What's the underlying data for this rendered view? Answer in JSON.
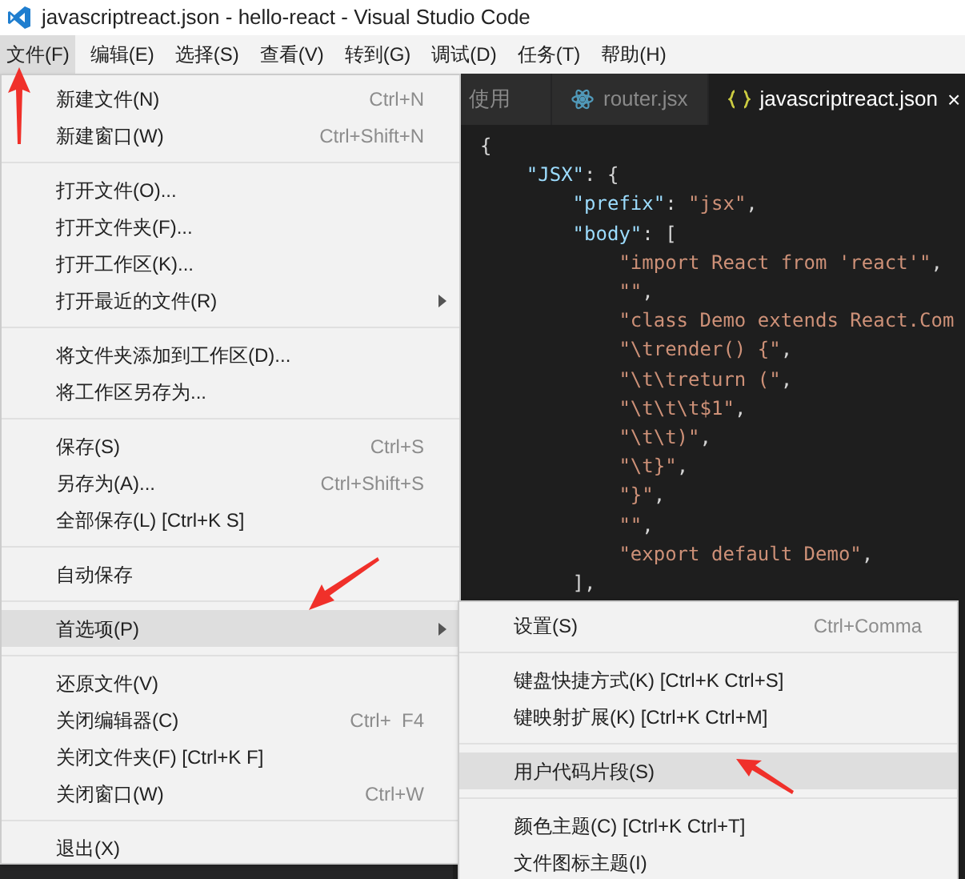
{
  "window": {
    "title": "javascriptreact.json - hello-react - Visual Studio Code"
  },
  "menu_bar": [
    {
      "label": "文件(F)",
      "selected": true
    },
    {
      "label": "编辑(E)",
      "selected": false
    },
    {
      "label": "选择(S)",
      "selected": false
    },
    {
      "label": "查看(V)",
      "selected": false
    },
    {
      "label": "转到(G)",
      "selected": false
    },
    {
      "label": "调试(D)",
      "selected": false
    },
    {
      "label": "任务(T)",
      "selected": false
    },
    {
      "label": "帮助(H)",
      "selected": false
    }
  ],
  "tabs": [
    {
      "label": "使用",
      "selected": false
    },
    {
      "label": "router.jsx",
      "selected": false
    },
    {
      "label": "javascriptreact.json",
      "selected": true,
      "close": "×"
    }
  ],
  "code": [
    {
      "tokens": [
        {
          "kind": "punct",
          "text": "{"
        }
      ],
      "children": [
        {
          "tokens": [
            {
              "kind": "key",
              "text": "\"JSX\""
            },
            {
              "kind": "punct",
              "text": ": {"
            }
          ],
          "children": [
            {
              "tokens": [
                {
                  "kind": "key",
                  "text": "\"prefix\""
                },
                {
                  "kind": "punct",
                  "text": ": "
                },
                {
                  "kind": "string",
                  "text": "\"jsx\""
                },
                {
                  "kind": "punct",
                  "text": ","
                }
              ]
            },
            {
              "tokens": [
                {
                  "kind": "key",
                  "text": "\"body\""
                },
                {
                  "kind": "punct",
                  "text": ": ["
                }
              ],
              "children": [
                {
                  "tokens": [
                    {
                      "kind": "string",
                      "text": "\"import React from 'react'\""
                    },
                    {
                      "kind": "punct",
                      "text": ","
                    }
                  ]
                },
                {
                  "tokens": [
                    {
                      "kind": "string",
                      "text": "\"\""
                    },
                    {
                      "kind": "punct",
                      "text": ","
                    }
                  ]
                },
                {
                  "tokens": [
                    {
                      "kind": "string",
                      "text": "\"class Demo extends React.Com"
                    }
                  ]
                },
                {
                  "tokens": [
                    {
                      "kind": "string",
                      "text": "\"\\trender() {\""
                    },
                    {
                      "kind": "punct",
                      "text": ","
                    }
                  ]
                },
                {
                  "tokens": [
                    {
                      "kind": "string",
                      "text": "\"\\t\\treturn (\""
                    },
                    {
                      "kind": "punct",
                      "text": ","
                    }
                  ]
                },
                {
                  "tokens": [
                    {
                      "kind": "string",
                      "text": "\"\\t\\t\\t$1\""
                    },
                    {
                      "kind": "punct",
                      "text": ","
                    }
                  ]
                },
                {
                  "tokens": [
                    {
                      "kind": "string",
                      "text": "\"\\t\\t)\""
                    },
                    {
                      "kind": "punct",
                      "text": ","
                    }
                  ]
                },
                {
                  "tokens": [
                    {
                      "kind": "string",
                      "text": "\"\\t}\""
                    },
                    {
                      "kind": "punct",
                      "text": ","
                    }
                  ]
                },
                {
                  "tokens": [
                    {
                      "kind": "string",
                      "text": "\"}\""
                    },
                    {
                      "kind": "punct",
                      "text": ","
                    }
                  ]
                },
                {
                  "tokens": [
                    {
                      "kind": "string",
                      "text": "\"\""
                    },
                    {
                      "kind": "punct",
                      "text": ","
                    }
                  ]
                },
                {
                  "tokens": [
                    {
                      "kind": "string",
                      "text": "\"export default Demo\""
                    },
                    {
                      "kind": "punct",
                      "text": ","
                    }
                  ]
                }
              ]
            },
            {
              "tokens": [
                {
                  "kind": "punct",
                  "text": "],"
                }
              ]
            }
          ]
        }
      ]
    }
  ],
  "file_menu": [
    {
      "kind": "item",
      "label": "新建文件(N)",
      "shortcut": "Ctrl+N",
      "submenu": false,
      "selected": false
    },
    {
      "kind": "item",
      "label": "新建窗口(W)",
      "shortcut": "Ctrl+Shift+N",
      "submenu": false,
      "selected": false
    },
    {
      "kind": "separator"
    },
    {
      "kind": "item",
      "label": "打开文件(O)...",
      "submenu": false,
      "selected": false
    },
    {
      "kind": "item",
      "label": "打开文件夹(F)...",
      "submenu": false,
      "selected": false
    },
    {
      "kind": "item",
      "label": "打开工作区(K)...",
      "submenu": false,
      "selected": false
    },
    {
      "kind": "item",
      "label": "打开最近的文件(R)",
      "submenu": true,
      "selected": false
    },
    {
      "kind": "separator"
    },
    {
      "kind": "item",
      "label": "将文件夹添加到工作区(D)...",
      "submenu": false,
      "selected": false
    },
    {
      "kind": "item",
      "label": "将工作区另存为...",
      "submenu": false,
      "selected": false
    },
    {
      "kind": "separator"
    },
    {
      "kind": "item",
      "label": "保存(S)",
      "shortcut": "Ctrl+S",
      "submenu": false,
      "selected": false
    },
    {
      "kind": "item",
      "label": "另存为(A)...",
      "shortcut": "Ctrl+Shift+S",
      "submenu": false,
      "selected": false
    },
    {
      "kind": "item",
      "label": "全部保存(L) [Ctrl+K S]",
      "submenu": false,
      "selected": false
    },
    {
      "kind": "separator"
    },
    {
      "kind": "item",
      "label": "自动保存",
      "submenu": false,
      "selected": false
    },
    {
      "kind": "separator"
    },
    {
      "kind": "item",
      "label": "首选项(P)",
      "submenu": true,
      "selected": true
    },
    {
      "kind": "separator"
    },
    {
      "kind": "item",
      "label": "还原文件(V)",
      "submenu": false,
      "selected": false
    },
    {
      "kind": "item",
      "label": "关闭编辑器(C)",
      "shortcut": "Ctrl+  F4",
      "submenu": false,
      "selected": false
    },
    {
      "kind": "item",
      "label": "关闭文件夹(F) [Ctrl+K F]",
      "submenu": false,
      "selected": false
    },
    {
      "kind": "item",
      "label": "关闭窗口(W)",
      "shortcut": "Ctrl+W",
      "submenu": false,
      "selected": false
    },
    {
      "kind": "separator"
    },
    {
      "kind": "item",
      "label": "退出(X)",
      "submenu": false,
      "selected": false
    }
  ],
  "preferences_menu": [
    {
      "kind": "item",
      "label": "设置(S)",
      "shortcut": "Ctrl+Comma",
      "selected": false
    },
    {
      "kind": "separator"
    },
    {
      "kind": "item",
      "label": "键盘快捷方式(K) [Ctrl+K Ctrl+S]",
      "selected": false
    },
    {
      "kind": "item",
      "label": "键映射扩展(K) [Ctrl+K Ctrl+M]",
      "selected": false
    },
    {
      "kind": "separator"
    },
    {
      "kind": "item",
      "label": "用户代码片段(S)",
      "selected": true
    },
    {
      "kind": "separator"
    },
    {
      "kind": "item",
      "label": "颜色主题(C) [Ctrl+K Ctrl+T]",
      "selected": false
    },
    {
      "kind": "item",
      "label": "文件图标主题(I)",
      "selected": false
    }
  ]
}
